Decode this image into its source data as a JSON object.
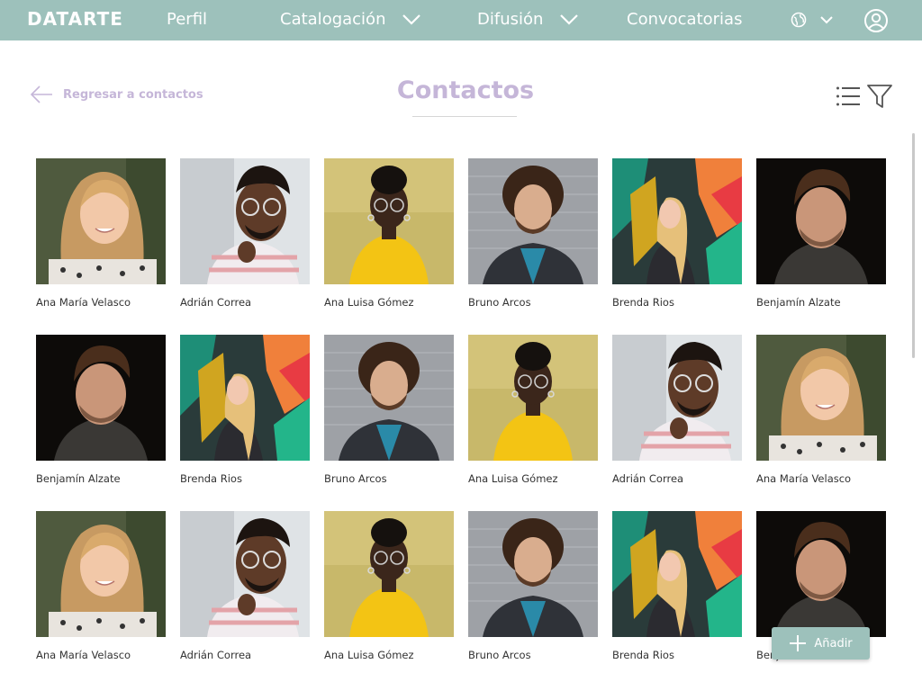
{
  "header": {
    "logo": "DATARTE",
    "nav": [
      {
        "label": "Perfil"
      },
      {
        "label": "Catalogación"
      },
      {
        "label": "Difusión"
      },
      {
        "label": "Convocatorias"
      }
    ],
    "language_icon": "globe-icon",
    "user_icon": "user-circle-icon"
  },
  "page": {
    "back_label": "Regresar a contactos",
    "title": "Contactos"
  },
  "contacts": [
    {
      "name": "Ana María Velasco",
      "portrait": "ana-maria"
    },
    {
      "name": "Adrián Correa",
      "portrait": "adrian"
    },
    {
      "name": "Ana Luisa Gómez",
      "portrait": "ana-luisa"
    },
    {
      "name": "Bruno Arcos",
      "portrait": "bruno"
    },
    {
      "name": "Brenda Rios",
      "portrait": "brenda"
    },
    {
      "name": "Benjamín Alzate",
      "portrait": "benjamin"
    },
    {
      "name": "Benjamín Alzate",
      "portrait": "benjamin"
    },
    {
      "name": "Brenda Rios",
      "portrait": "brenda"
    },
    {
      "name": "Bruno Arcos",
      "portrait": "bruno"
    },
    {
      "name": "Ana Luisa Gómez",
      "portrait": "ana-luisa"
    },
    {
      "name": "Adrián Correa",
      "portrait": "adrian"
    },
    {
      "name": "Ana María Velasco",
      "portrait": "ana-maria"
    },
    {
      "name": "Ana María Velasco",
      "portrait": "ana-maria"
    },
    {
      "name": "Adrián Correa",
      "portrait": "adrian"
    },
    {
      "name": "Ana Luisa Gómez",
      "portrait": "ana-luisa"
    },
    {
      "name": "Bruno Arcos",
      "portrait": "bruno"
    },
    {
      "name": "Brenda Rios",
      "portrait": "brenda"
    },
    {
      "name": "Benjamín Alzate",
      "portrait": "benjamin"
    }
  ],
  "add_button": {
    "label": "Añadir"
  },
  "colors": {
    "accent": "#9dc1bb",
    "title": "#c5b6d8"
  }
}
